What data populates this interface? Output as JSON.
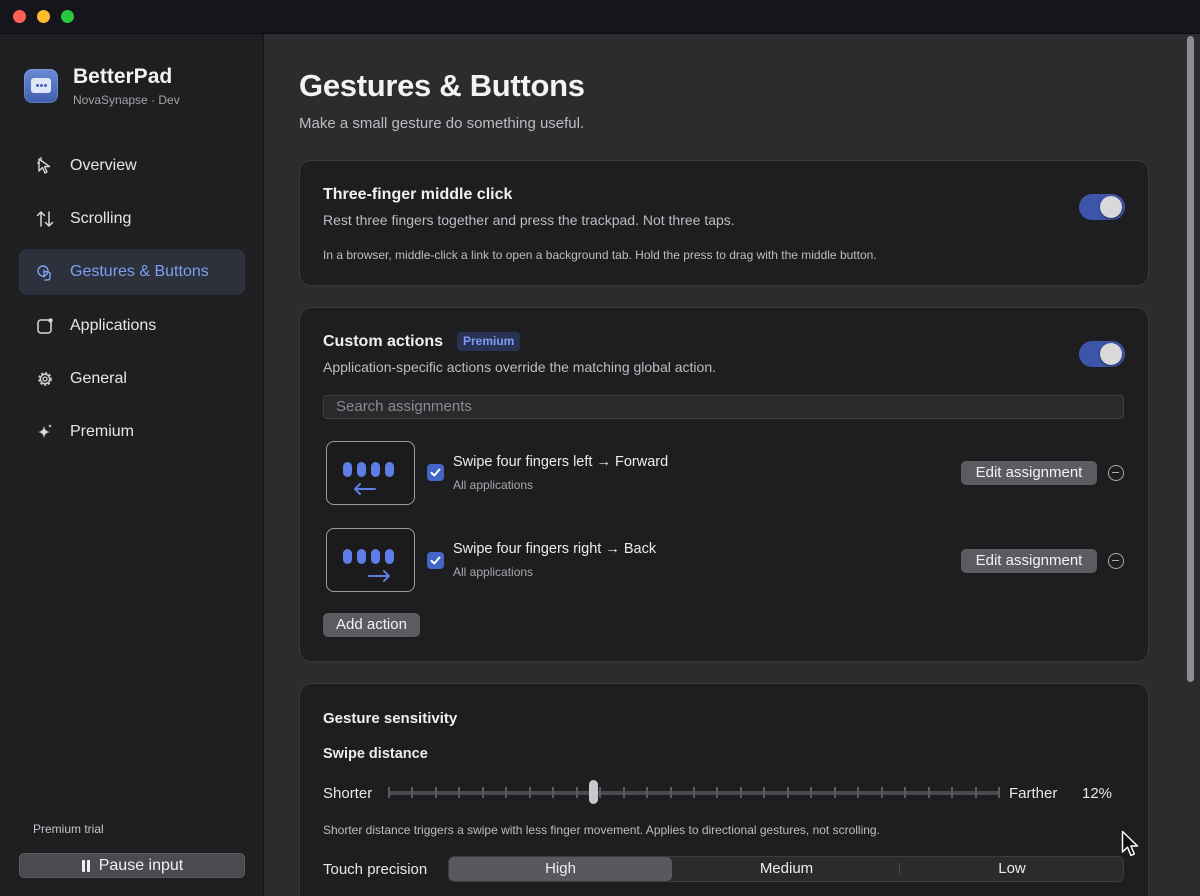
{
  "app": {
    "name": "BetterPad",
    "subtitle": "NovaSynapse · Dev"
  },
  "sidebar": {
    "items": [
      {
        "label": "Overview",
        "icon": "cursor-arrow-icon",
        "active": false
      },
      {
        "label": "Scrolling",
        "icon": "up-down-arrows-icon",
        "active": false
      },
      {
        "label": "Gestures & Buttons",
        "icon": "tap-gesture-icon",
        "active": true
      },
      {
        "label": "Applications",
        "icon": "app-window-icon",
        "active": false
      },
      {
        "label": "General",
        "icon": "gear-icon",
        "active": false
      },
      {
        "label": "Premium",
        "icon": "sparkles-icon",
        "active": false
      }
    ],
    "trial_label": "Premium trial",
    "pause_label": "Pause input"
  },
  "page": {
    "title": "Gestures & Buttons",
    "subtitle": "Make a small gesture do something useful."
  },
  "middle_click": {
    "title": "Three-finger middle click",
    "desc": "Rest three fingers together and press the trackpad. Not three taps.",
    "note": "In a browser, middle-click a link to open a background tab. Hold the press to drag with the middle button.",
    "enabled": true
  },
  "custom_actions": {
    "title": "Custom actions",
    "badge": "Premium",
    "desc": "Application-specific actions override the matching global action.",
    "enabled": true,
    "search_placeholder": "Search assignments",
    "rows": [
      {
        "title": "Swipe four fingers left → Forward",
        "scope": "All applications",
        "direction": "left",
        "checked": true,
        "edit_label": "Edit assignment"
      },
      {
        "title": "Swipe four fingers right → Back",
        "scope": "All applications",
        "direction": "right",
        "checked": true,
        "edit_label": "Edit assignment"
      }
    ],
    "add_label": "Add action"
  },
  "sensitivity": {
    "title": "Gesture sensitivity",
    "swipe_label": "Swipe distance",
    "min_label": "Shorter",
    "max_label": "Farther",
    "value_text": "12%",
    "value": 0.33,
    "note": "Shorter distance triggers a swipe with less finger movement. Applies to directional gestures, not scrolling.",
    "precision_label": "Touch precision",
    "precision_options": [
      "High",
      "Medium",
      "Low"
    ],
    "precision_selected": "High"
  },
  "colors": {
    "accent": "#7f9ff0",
    "toggle_on": "#3d55a8",
    "badge_bg": "#2a3254"
  }
}
